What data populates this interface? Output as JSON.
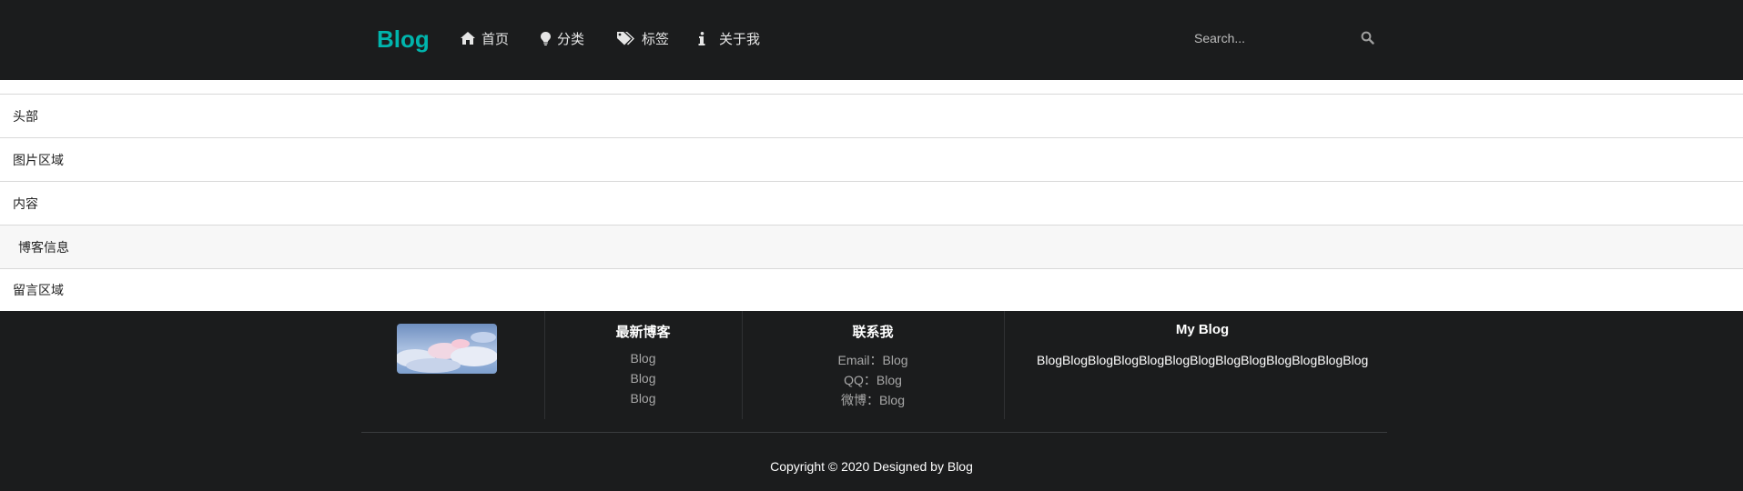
{
  "header": {
    "brand": "Blog",
    "nav": [
      {
        "label": "首页",
        "icon": "home-icon"
      },
      {
        "label": "分类",
        "icon": "lightbulb-icon"
      },
      {
        "label": "标签",
        "icon": "tags-icon"
      },
      {
        "label": "关于我",
        "icon": "info-icon"
      }
    ],
    "search": {
      "placeholder": "Search...",
      "icon": "search-icon"
    }
  },
  "sections": [
    {
      "label": "头部"
    },
    {
      "label": "图片区域"
    },
    {
      "label": "内容"
    },
    {
      "label": "博客信息"
    },
    {
      "label": "留言区域"
    }
  ],
  "footer": {
    "latest": {
      "title": "最新博客",
      "links": [
        "Blog",
        "Blog",
        "Blog"
      ]
    },
    "contact": {
      "title": "联系我",
      "items": [
        "Email：Blog",
        "QQ：Blog",
        "微博：Blog"
      ]
    },
    "about": {
      "title": "My Blog",
      "text": "BlogBlogBlogBlogBlogBlogBlogBlogBlogBlogBlogBlogBlog"
    },
    "copyright": "Copyright © 2020 Designed by Blog"
  },
  "colors": {
    "brand": "#00b5ad",
    "dark_bg": "#1b1c1d"
  }
}
